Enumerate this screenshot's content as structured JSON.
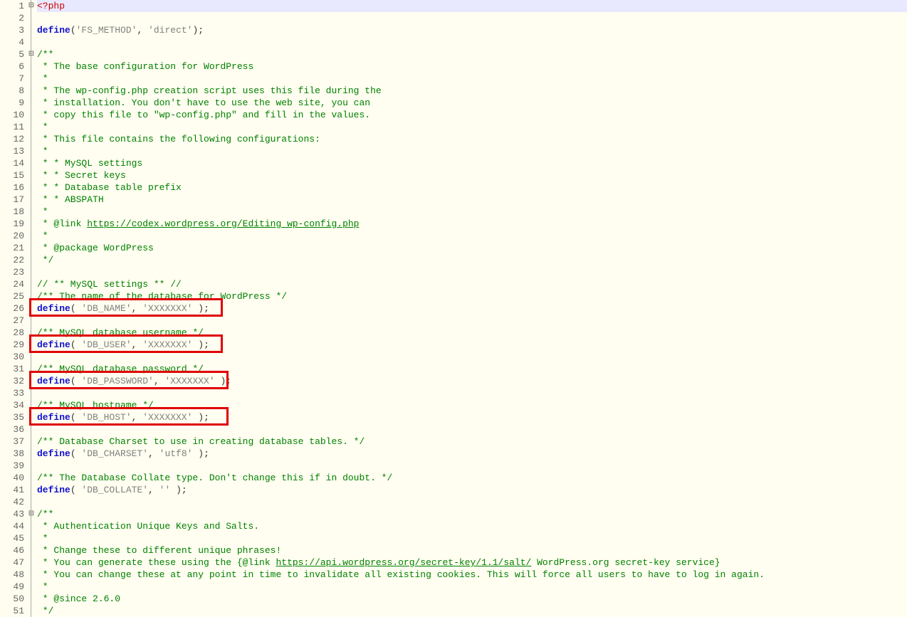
{
  "fold_markers": [
    {
      "line": 1,
      "symbol": "⊟"
    },
    {
      "line": 5,
      "symbol": "⊟"
    },
    {
      "line": 43,
      "symbol": "⊟"
    }
  ],
  "highlighted_line": 1,
  "code": {
    "l1": "<?php",
    "l3_kw": "define",
    "l3_str1": "'FS_METHOD'",
    "l3_str2": "'direct'",
    "l5": "/**",
    "l6": " * The base configuration for WordPress",
    "l7": " *",
    "l8": " * The wp-config.php creation script uses this file during the",
    "l9": " * installation. You don't have to use the web site, you can",
    "l10": " * copy this file to \"wp-config.php\" and fill in the values.",
    "l11": " *",
    "l12": " * This file contains the following configurations:",
    "l13": " *",
    "l14": " * * MySQL settings",
    "l15": " * * Secret keys",
    "l16": " * * Database table prefix",
    "l17": " * * ABSPATH",
    "l18": " *",
    "l19a": " * @link ",
    "l19link": "https://codex.wordpress.org/Editing_wp-config.php",
    "l20": " *",
    "l21": " * @package WordPress",
    "l22": " */",
    "l24": "// ** MySQL settings ** //",
    "l25": "/** The name of the database for WordPress */",
    "l26_kw": "define",
    "l26_str1": "'DB_NAME'",
    "l26_str2": "'XXXXXXX'",
    "l28": "/** MySQL database username */",
    "l29_kw": "define",
    "l29_str1": "'DB_USER'",
    "l29_str2": "'XXXXXXX'",
    "l31": "/** MySQL database password */",
    "l32_kw": "define",
    "l32_str1": "'DB_PASSWORD'",
    "l32_str2": "'XXXXXXX'",
    "l34": "/** MySQL hostname */",
    "l35_kw": "define",
    "l35_str1": "'DB_HOST'",
    "l35_str2": "'XXXXXXX'",
    "l37": "/** Database Charset to use in creating database tables. */",
    "l38_kw": "define",
    "l38_str1": "'DB_CHARSET'",
    "l38_str2": "'utf8'",
    "l40": "/** The Database Collate type. Don't change this if in doubt. */",
    "l41_kw": "define",
    "l41_str1": "'DB_COLLATE'",
    "l41_str2": "''",
    "l43": "/**",
    "l44": " * Authentication Unique Keys and Salts.",
    "l45": " *",
    "l46": " * Change these to different unique phrases!",
    "l47a": " * You can generate these using the {@link ",
    "l47link": "https://api.wordpress.org/secret-key/1.1/salt/",
    "l47b": " WordPress.org secret-key service}",
    "l48": " * You can change these at any point in time to invalidate all existing cookies. This will force all users to have to log in again.",
    "l49": " *",
    "l50": " * @since 2.6.0",
    "l51": " */"
  }
}
